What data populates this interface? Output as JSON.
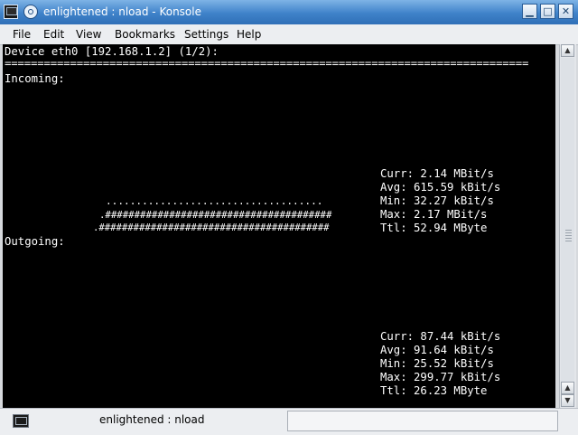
{
  "window": {
    "title": "enlightened : nload - Konsole",
    "buttons": {
      "minimize": "▁",
      "maximize": "□",
      "close": "✕"
    }
  },
  "menu": [
    "File",
    "Edit",
    "View",
    "Bookmarks",
    "Settings",
    "Help"
  ],
  "terminal": {
    "device_line": "Device eth0 [192.168.1.2] (1/2):",
    "separator": "================================================================================",
    "incoming_label": "Incoming:",
    "incoming_stats": [
      "Curr: 2.14 MBit/s",
      "Avg: 615.59 kBit/s",
      "Min: 32.27 kBit/s",
      "Max: 2.17 MBit/s",
      "Ttl: 52.94 MByte"
    ],
    "incoming_graph": [
      "....................................",
      ".#######################################",
      ".########################################"
    ],
    "outgoing_label": "Outgoing:",
    "outgoing_stats": [
      "Curr: 87.44 kBit/s",
      "Avg: 91.64 kBit/s",
      "Min: 25.52 kBit/s",
      "Max: 299.77 kBit/s",
      "Ttl: 26.23 MByte"
    ]
  },
  "statusbar": {
    "tab_label": "enlightened : nload"
  }
}
